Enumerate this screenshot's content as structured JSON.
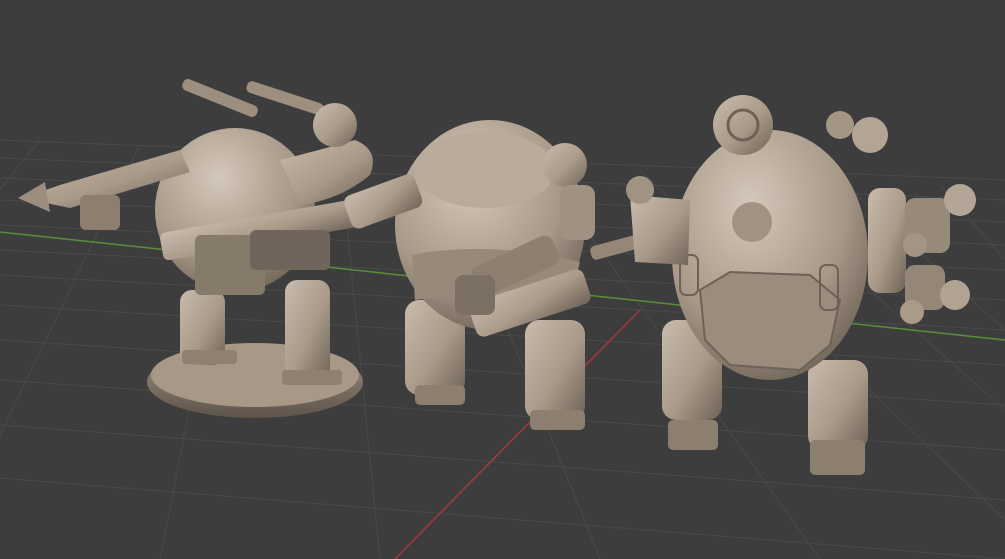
{
  "viewport": {
    "background": "#3d3d3d",
    "grid_color": "#4a4a4a",
    "x_axis_color": "#a8383f",
    "y_axis_color": "#5a8f3a"
  },
  "models": [
    {
      "name": "mech-with-cannon-on-base",
      "color": "#b0a293"
    },
    {
      "name": "mech-with-gatling-front",
      "color": "#ab9d8d"
    },
    {
      "name": "mech-with-turrets-rear",
      "color": "#ac9e8e"
    }
  ]
}
